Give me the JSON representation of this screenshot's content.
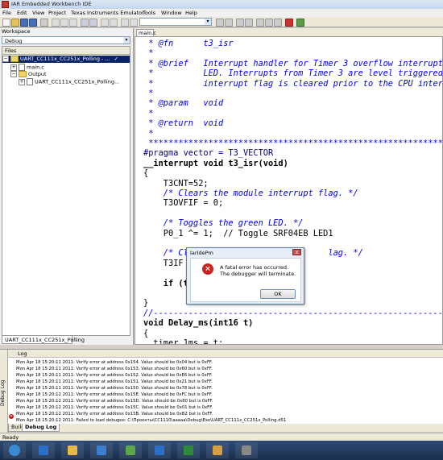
{
  "window": {
    "title": "IAR Embedded Workbench IDE"
  },
  "menu": [
    "File",
    "Edit",
    "View",
    "Project",
    "Texas Instruments Emulator",
    "Tools",
    "Window",
    "Help"
  ],
  "workspace": {
    "title": "Workspace",
    "config": "Debug",
    "files_header": "Files",
    "tree": [
      {
        "label": "UART_CC111x_CC251x_Polling - ...",
        "check": "✓"
      },
      {
        "label": "main.c"
      },
      {
        "label": "Output"
      },
      {
        "label": "UART_CC111x_CC251x_Polling..."
      }
    ],
    "tab": "UART_CC111x_CC251x_Polling"
  },
  "editor": {
    "tab": "main.c",
    "lines": [
      {
        "t": " * @fn      t3_isr",
        "c": "cm"
      },
      {
        "t": " *",
        "c": "cm"
      },
      {
        "t": " * @brief   Interrupt handler for Timer 3 overflow interrupts",
        "c": "cm"
      },
      {
        "t": " *          LED. Interrupts from Timer 3 are level triggered,",
        "c": "cm"
      },
      {
        "t": " *          interrupt flag is cleared prior to the CPU interru",
        "c": "cm"
      },
      {
        "t": " *",
        "c": "cm"
      },
      {
        "t": " * @param   void",
        "c": "cm"
      },
      {
        "t": " *",
        "c": "cm"
      },
      {
        "t": " * @return  void",
        "c": "cm"
      },
      {
        "t": " *",
        "c": "cm"
      },
      {
        "t": " ******************************************************************",
        "c": "cm"
      },
      {
        "t": "#pragma vector = T3_VECTOR",
        "c": "pp"
      },
      {
        "t": "__interrupt void t3_isr(void)",
        "c": "kw"
      },
      {
        "t": "{",
        "c": ""
      },
      {
        "t": "    T3CNT=52;",
        "c": ""
      },
      {
        "t": "    /* Clears the module interrupt flag. */",
        "c": "cm"
      },
      {
        "t": "    T3OVFIF = 0;",
        "c": ""
      },
      {
        "t": "",
        "c": ""
      },
      {
        "t": "    /* Toggles the green LED. */",
        "c": "cm"
      },
      {
        "t": "    P0_1 ^= 1;  // Toggle SRF04EB LED1",
        "c": ""
      },
      {
        "t": "",
        "c": ""
      },
      {
        "t": "    /* Cl                            lag. */",
        "c": "cm"
      },
      {
        "t": "    T3IF",
        "c": ""
      },
      {
        "t": "",
        "c": ""
      },
      {
        "t": "    if (t",
        "c": "kw"
      },
      {
        "t": "",
        "c": ""
      },
      {
        "t": "}",
        "c": ""
      },
      {
        "t": "//-----------------------------------------------------------------",
        "c": "cm"
      },
      {
        "t": "void Delay_ms(int16 t)",
        "c": "kw"
      },
      {
        "t": "{",
        "c": ""
      },
      {
        "t": "  timer_1ms = t;",
        "c": ""
      }
    ]
  },
  "dialog": {
    "title": "IarIdePm",
    "message_1": "A fatal error has occurred.",
    "message_2": "The debugger will terminate.",
    "ok": "OK",
    "close": "x"
  },
  "log": {
    "side_label": "Debug Log",
    "header": "Log",
    "lines": [
      "Mon Apr 18 15:20:11 2011: Verify error at address 0x154. Value should be 0x04  but is 0xFF.",
      "Mon Apr 18 15:20:11 2011: Verify error at address 0x153. Value should be 0x60  but is 0xFF.",
      "Mon Apr 18 15:20:11 2011: Verify error at address 0x152. Value should be 0xE6  but is 0xFF.",
      "Mon Apr 18 15:20:11 2011: Verify error at address 0x151. Value should be 0x21  but is 0xFF.",
      "Mon Apr 18 15:20:11 2011: Verify error at address 0x150. Value should be 0x78  but is 0xFF.",
      "Mon Apr 18 15:20:12 2011: Verify error at address 0x15E. Value should be 0xFC  but is 0xFF.",
      "Mon Apr 18 15:20:12 2011: Verify error at address 0x15D. Value should be 0x80  but is 0xFF.",
      "Mon Apr 18 15:20:12 2011: Verify error at address 0x15C. Value should be 0x01  but is 0xFF.",
      "Mon Apr 18 15:20:12 2011: Verify error at address 0x15B. Value should be 0xB2  but is 0xFF.",
      "Mon Apr 18 15:20:12 2011: Failed to load debugee: C:\\Проекты\\CC1110\\aaaaa\\Debug\\Exe\\UART_CC111x_CC251x_Polling.d51"
    ],
    "tabs": [
      "Build",
      "Debug Log"
    ]
  },
  "status": {
    "text": "Ready"
  },
  "taskbar": {
    "items": [
      {
        "icon": "start-orb-icon",
        "color": "#3a8ad6"
      },
      {
        "icon": "ie-icon",
        "color": "#2a6fc9"
      },
      {
        "icon": "explorer-icon",
        "color": "#e8b84a"
      },
      {
        "icon": "media-icon",
        "color": "#3c7fd0"
      },
      {
        "icon": "turtle-icon",
        "color": "#5ca64a"
      },
      {
        "icon": "ie-icon",
        "color": "#2a6fc9"
      },
      {
        "icon": "excel-icon",
        "color": "#2f8b3a"
      },
      {
        "icon": "paint-icon",
        "color": "#d4a040"
      },
      {
        "icon": "iar-icon",
        "color": "#888888"
      }
    ]
  }
}
